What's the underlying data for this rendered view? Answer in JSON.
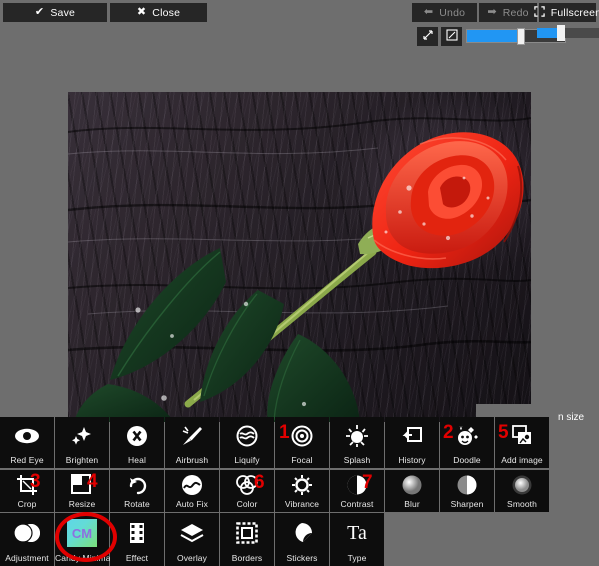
{
  "toolbar": {
    "save_label": "Save",
    "save_icon": "check-icon",
    "close_label": "Close",
    "close_icon": "x-icon",
    "undo_label": "Undo",
    "redo_label": "Redo",
    "fullscreen_label": "Fullscreen",
    "zoom_value": "100%",
    "zoom_percent": 100,
    "fit_icon": "fit-to-screen-icon",
    "actual_icon": "actual-size-icon"
  },
  "canvas": {
    "image_description": "Red rose with water droplets lying on dark textured stone"
  },
  "side_panel": {
    "label": "n size",
    "full_label": "Brush size"
  },
  "tools": {
    "row1": [
      {
        "label": "Red Eye",
        "icon": "eye-icon"
      },
      {
        "label": "Brighten",
        "icon": "sparkles-icon"
      },
      {
        "label": "Heal",
        "icon": "heal-bandage-icon"
      },
      {
        "label": "Airbrush",
        "icon": "airbrush-icon"
      },
      {
        "label": "Liquify",
        "icon": "liquify-icon"
      },
      {
        "label": "Focal",
        "icon": "focal-target-icon",
        "badge": "1"
      },
      {
        "label": "Splash",
        "icon": "splash-icon"
      },
      {
        "label": "History",
        "icon": "history-icon"
      },
      {
        "label": "Doodle",
        "icon": "doodle-icon",
        "badge": "2"
      },
      {
        "label": "Add image",
        "icon": "add-image-icon",
        "badge": "5"
      }
    ],
    "row2": [
      {
        "label": "Crop",
        "icon": "crop-icon",
        "badge": "3"
      },
      {
        "label": "Resize",
        "icon": "resize-icon",
        "badge": "4"
      },
      {
        "label": "Rotate",
        "icon": "rotate-icon"
      },
      {
        "label": "Auto Fix",
        "icon": "auto-fix-icon"
      },
      {
        "label": "Color",
        "icon": "color-circles-icon",
        "badge": "6"
      },
      {
        "label": "Vibrance",
        "icon": "vibrance-sun-icon"
      },
      {
        "label": "Contrast",
        "icon": "contrast-icon",
        "badge": "7"
      },
      {
        "label": "Blur",
        "icon": "blur-icon"
      },
      {
        "label": "Sharpen",
        "icon": "sharpen-icon"
      },
      {
        "label": "Smooth",
        "icon": "smooth-icon"
      }
    ],
    "row3": [
      {
        "label": "Adjustment",
        "icon": "adjustment-icon",
        "highlighted": true
      },
      {
        "label": "Candy Minimal",
        "icon": "candy-minimal-thumb",
        "thumb_text": "CM"
      },
      {
        "label": "Effect",
        "icon": "film-strip-icon"
      },
      {
        "label": "Overlay",
        "icon": "layers-icon"
      },
      {
        "label": "Borders",
        "icon": "border-frame-icon"
      },
      {
        "label": "Stickers",
        "icon": "sticker-icon"
      },
      {
        "label": "Type",
        "icon": "type-Ta-icon",
        "glyph": "Ta"
      }
    ]
  },
  "annotations": {
    "highlight_shape": "red-ellipse",
    "highlight_target": "Adjustment",
    "numbers": [
      "1",
      "2",
      "3",
      "4",
      "5",
      "6",
      "7"
    ],
    "color": "#e10000"
  },
  "colors": {
    "accent": "#2196f3",
    "chrome": "#6e6e6e",
    "tile": "#0d0d0d",
    "button": "#262626",
    "annotation": "#e10000"
  }
}
